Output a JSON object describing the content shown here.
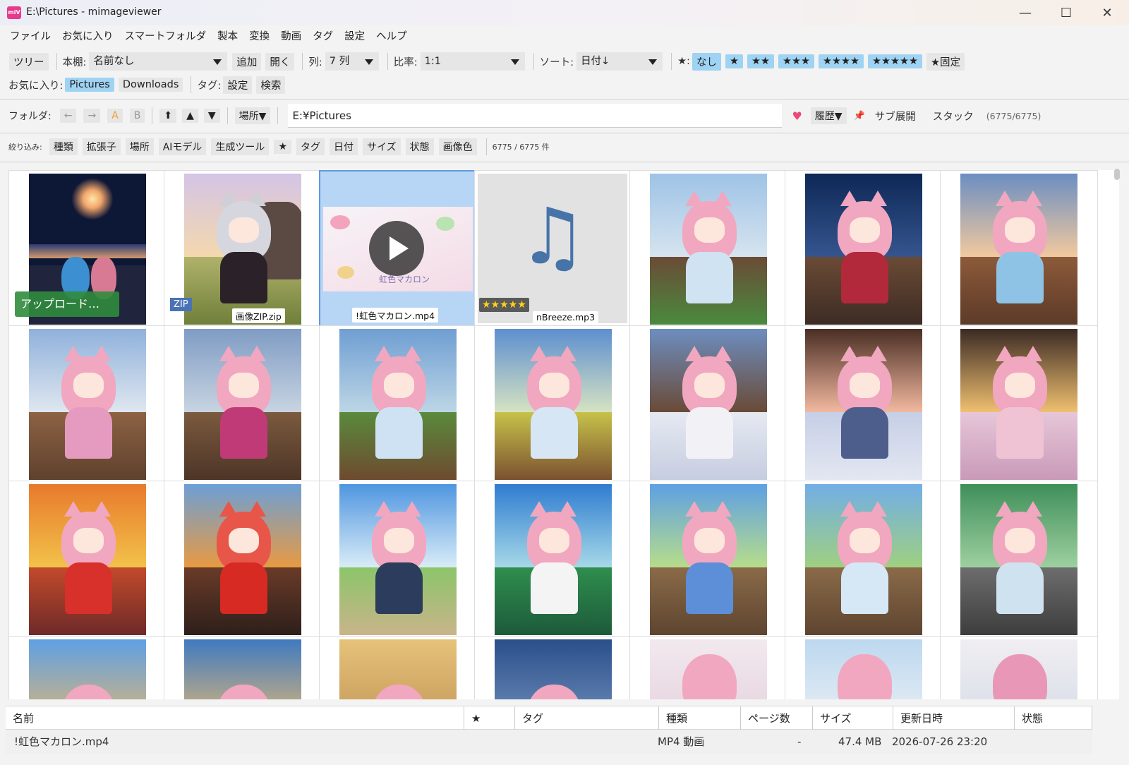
{
  "window": {
    "icon_text": "miV",
    "title": "E:\\Pictures - mimageviewer"
  },
  "menu": [
    "ファイル",
    "お気に入り",
    "スマートフォルダ",
    "製本",
    "変換",
    "動画",
    "タグ",
    "設定",
    "ヘルプ"
  ],
  "toolbar1": {
    "tree_label": "ツリー",
    "shelf_label": "本棚:",
    "shelf_value": "名前なし",
    "add_button": "追加",
    "open_button": "開く",
    "columns_label": "列:",
    "columns_value": "7 列",
    "ratio_label": "比率:",
    "ratio_value": "1:1",
    "sort_label": "ソート:",
    "sort_value": "日付↓",
    "star_label": "★:",
    "star_filters": [
      "なし",
      "★",
      "★★",
      "★★★",
      "★★★★",
      "★★★★★"
    ],
    "star_fixed": "★固定"
  },
  "toolbar2": {
    "favorites_label": "お気に入り:",
    "favorites": [
      "Pictures",
      "Downloads"
    ],
    "tag_label": "タグ:",
    "tag_settings": "設定",
    "tag_search": "検索"
  },
  "folderbar": {
    "label": "フォルダ:",
    "back": "←",
    "forward": "→",
    "a": "A",
    "b": "B",
    "up_top": "⬆",
    "up": "▲",
    "down": "▼",
    "place": "場所▼",
    "path": "E:¥Pictures",
    "heart": "♥",
    "history": "履歴▼",
    "pin": "📌",
    "sub_expand": "サブ展開",
    "stack": "スタック",
    "count": "(6775/6775)"
  },
  "filterbar": {
    "label": "絞り込み:",
    "filters": [
      "種類",
      "拡張子",
      "場所",
      "AIモデル",
      "生成ツール",
      "★",
      "タグ",
      "日付",
      "サイズ",
      "状態",
      "画像色"
    ],
    "count": "6775 / 6775 件"
  },
  "grid": {
    "upload_label": "アップロード…",
    "zip_badge": "ZIP",
    "zip_caption": "画像ZIP.zip",
    "video_caption": "!虹色マカロン.mp4",
    "video_title": "虹色マカロン",
    "audio_caption": "nBreeze.mp3",
    "audio_stars": "★★★★★",
    "music_icon": "♫"
  },
  "list": {
    "headers": [
      "名前",
      "★",
      "タグ",
      "種類",
      "ページ数",
      "サイズ",
      "更新日時",
      "状態"
    ],
    "row": {
      "name": "!虹色マカロン.mp4",
      "kind": "MP4 動画",
      "pages": "-",
      "size": "47.4 MB",
      "modified": "2026-07-26 23:20"
    }
  },
  "colors": {
    "selection": "#b7d5f5",
    "highlight": "#9fd3f3",
    "accent": "#e83a8c"
  }
}
